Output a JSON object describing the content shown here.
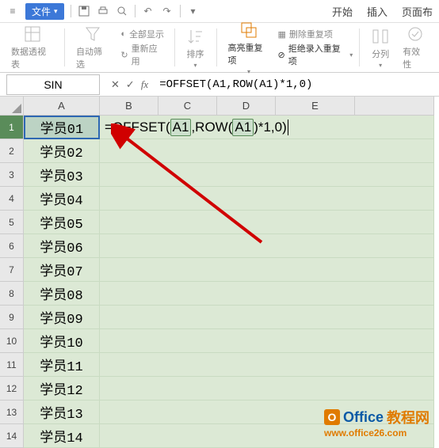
{
  "menu": {
    "file_label": "文件",
    "tabs": {
      "start": "开始",
      "insert": "插入",
      "page": "页面布"
    }
  },
  "ribbon": {
    "pivot": "数据透视表",
    "autofilter": "自动筛选",
    "showall": "全部显示",
    "reapply": "重新应用",
    "sort": "排序",
    "highlight_dup": "高亮重复项",
    "reject_dup": "拒绝录入重复项",
    "delete_dup": "删除重复项",
    "split": "分列",
    "validity": "有效性"
  },
  "refbar": {
    "namebox": "SIN",
    "formula": "=OFFSET(A1,ROW(A1)*1,0)"
  },
  "columns": [
    "A",
    "B",
    "C",
    "D",
    "E"
  ],
  "overlay": {
    "p1": "=OFFSET(",
    "ref1": "A1",
    "p2": ",ROW(",
    "ref2": "A1",
    "p3": ")*1,0)"
  },
  "rows": [
    {
      "num": "1",
      "a": "学员01"
    },
    {
      "num": "2",
      "a": "学员02"
    },
    {
      "num": "3",
      "a": "学员03"
    },
    {
      "num": "4",
      "a": "学员04"
    },
    {
      "num": "5",
      "a": "学员05"
    },
    {
      "num": "6",
      "a": "学员06"
    },
    {
      "num": "7",
      "a": "学员07"
    },
    {
      "num": "8",
      "a": "学员08"
    },
    {
      "num": "9",
      "a": "学员09"
    },
    {
      "num": "10",
      "a": "学员10"
    },
    {
      "num": "11",
      "a": "学员11"
    },
    {
      "num": "12",
      "a": "学员12"
    },
    {
      "num": "13",
      "a": "学员13"
    },
    {
      "num": "14",
      "a": "学员14"
    }
  ],
  "watermark": {
    "brand_a": "Office",
    "brand_b": "教程网",
    "url": "www.office26.com"
  }
}
